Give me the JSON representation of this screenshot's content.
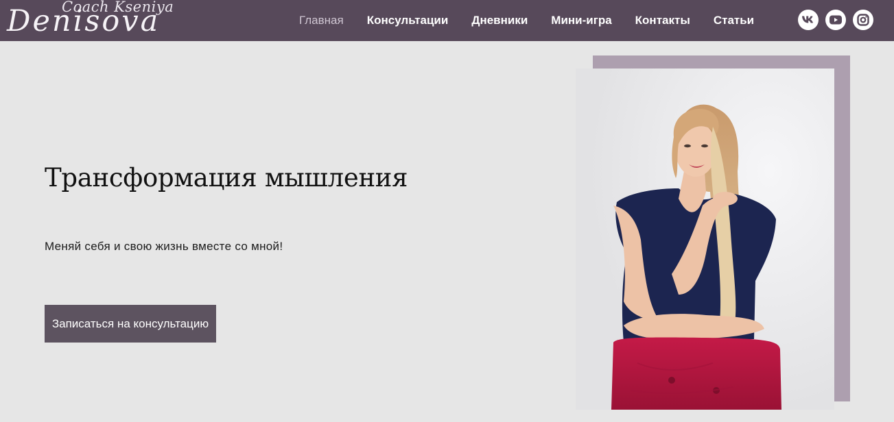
{
  "header": {
    "logo": {
      "subtitle": "Coach Kseniya",
      "name": "Denisova"
    },
    "nav": [
      {
        "label": "Главная",
        "active": true
      },
      {
        "label": "Консультации",
        "active": false
      },
      {
        "label": "Дневники",
        "active": false
      },
      {
        "label": "Мини-игра",
        "active": false
      },
      {
        "label": "Контакты",
        "active": false
      },
      {
        "label": "Статьи",
        "active": false
      }
    ],
    "socials": [
      {
        "icon": "vk-icon"
      },
      {
        "icon": "youtube-icon"
      },
      {
        "icon": "instagram-icon"
      }
    ]
  },
  "hero": {
    "title": "Трансформация мышления",
    "subtitle": "Меняй себя и свою жизнь вместе со мной!",
    "cta_label": "Записаться на консультацию"
  },
  "colors": {
    "header_bg": "#57495a",
    "page_bg": "#e6e6e6",
    "button_bg": "#5d5360",
    "photo_frame": "#ad9faf",
    "chair": "#b5163f",
    "dress": "#1c2550"
  }
}
